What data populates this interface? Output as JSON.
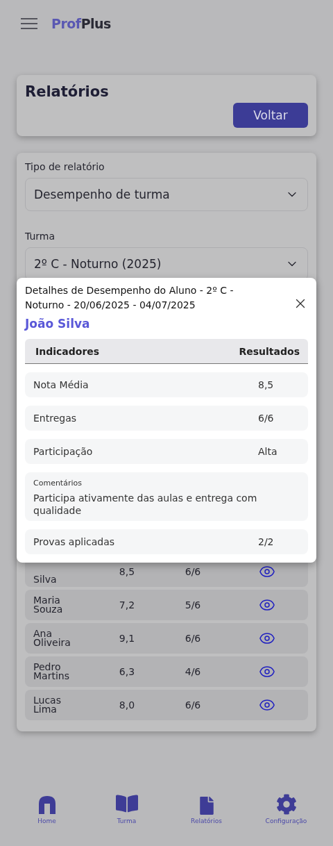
{
  "header": {
    "logo": {
      "primary": "Prof",
      "secondary": "Plus"
    }
  },
  "page": {
    "title": "Relatórios",
    "back_button": "Voltar"
  },
  "filters": [
    {
      "label": "Tipo de relatório",
      "value": "Desempenho de turma"
    },
    {
      "label": "Turma",
      "value": "2º C - Noturno (2025)"
    }
  ],
  "students": [
    {
      "name": "Silva",
      "grade": "8,5",
      "deliveries": "6/6",
      "partly_hidden": true
    },
    {
      "name": "Maria Souza",
      "grade": "7,2",
      "deliveries": "5/6",
      "partly_hidden": false
    },
    {
      "name": "Ana Oliveira",
      "grade": "9,1",
      "deliveries": "6/6",
      "partly_hidden": false
    },
    {
      "name": "Pedro Martins",
      "grade": "6,3",
      "deliveries": "4/6",
      "partly_hidden": false
    },
    {
      "name": "Lucas Lima",
      "grade": "8,0",
      "deliveries": "6/6",
      "partly_hidden": false
    }
  ],
  "modal": {
    "title": "Detalhes de Desempenho do Aluno - 2º C - Noturno - 20/06/2025 - 04/07/2025",
    "student": "João Silva",
    "columns": [
      "Indicadores",
      "Resultados"
    ],
    "rows": [
      {
        "kind": "pair",
        "label": "Nota Média",
        "value": "8,5"
      },
      {
        "kind": "pair",
        "label": "Entregas",
        "value": "6/6"
      },
      {
        "kind": "pair",
        "label": "Participação",
        "value": "Alta"
      },
      {
        "kind": "comment",
        "label": "Comentários",
        "text": "Participa ativamente das aulas e entrega com qualidade"
      },
      {
        "kind": "pair",
        "label": "Provas aplicadas",
        "value": "2/2"
      }
    ]
  },
  "nav": [
    {
      "label": "Home"
    },
    {
      "label": "Turma"
    },
    {
      "label": "Relatórios"
    },
    {
      "label": "Configuração"
    }
  ]
}
